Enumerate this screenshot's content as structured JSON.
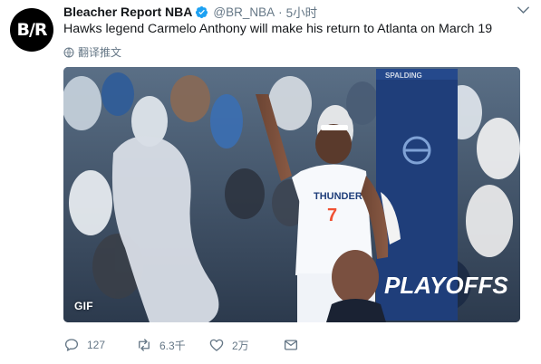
{
  "tweet": {
    "avatar_text": "B/R",
    "name": "Bleacher Report NBA",
    "handle": "@BR_NBA",
    "separator": "·",
    "time": "5小时",
    "text": "Hawks legend Carmelo Anthony will make his return to Atlanta on March 19",
    "translate_label": "翻译推文",
    "media": {
      "badge": "GIF",
      "jersey_team": "THUNDER",
      "jersey_number": "7",
      "banner_text": "PLAYOFFS",
      "board_text": "SPALDING"
    },
    "actions": {
      "reply_count": "127",
      "retweet_count": "6.3千",
      "like_count": "2万"
    },
    "colors": {
      "verified_blue": "#1da1f2",
      "secondary_text": "#657786",
      "thunder_blue": "#1f3e7a",
      "thunder_orange": "#f05133"
    },
    "icons": [
      "verified-badge-icon",
      "chevron-down-icon",
      "globe-icon",
      "reply-icon",
      "retweet-icon",
      "heart-icon",
      "direct-message-icon"
    ]
  }
}
